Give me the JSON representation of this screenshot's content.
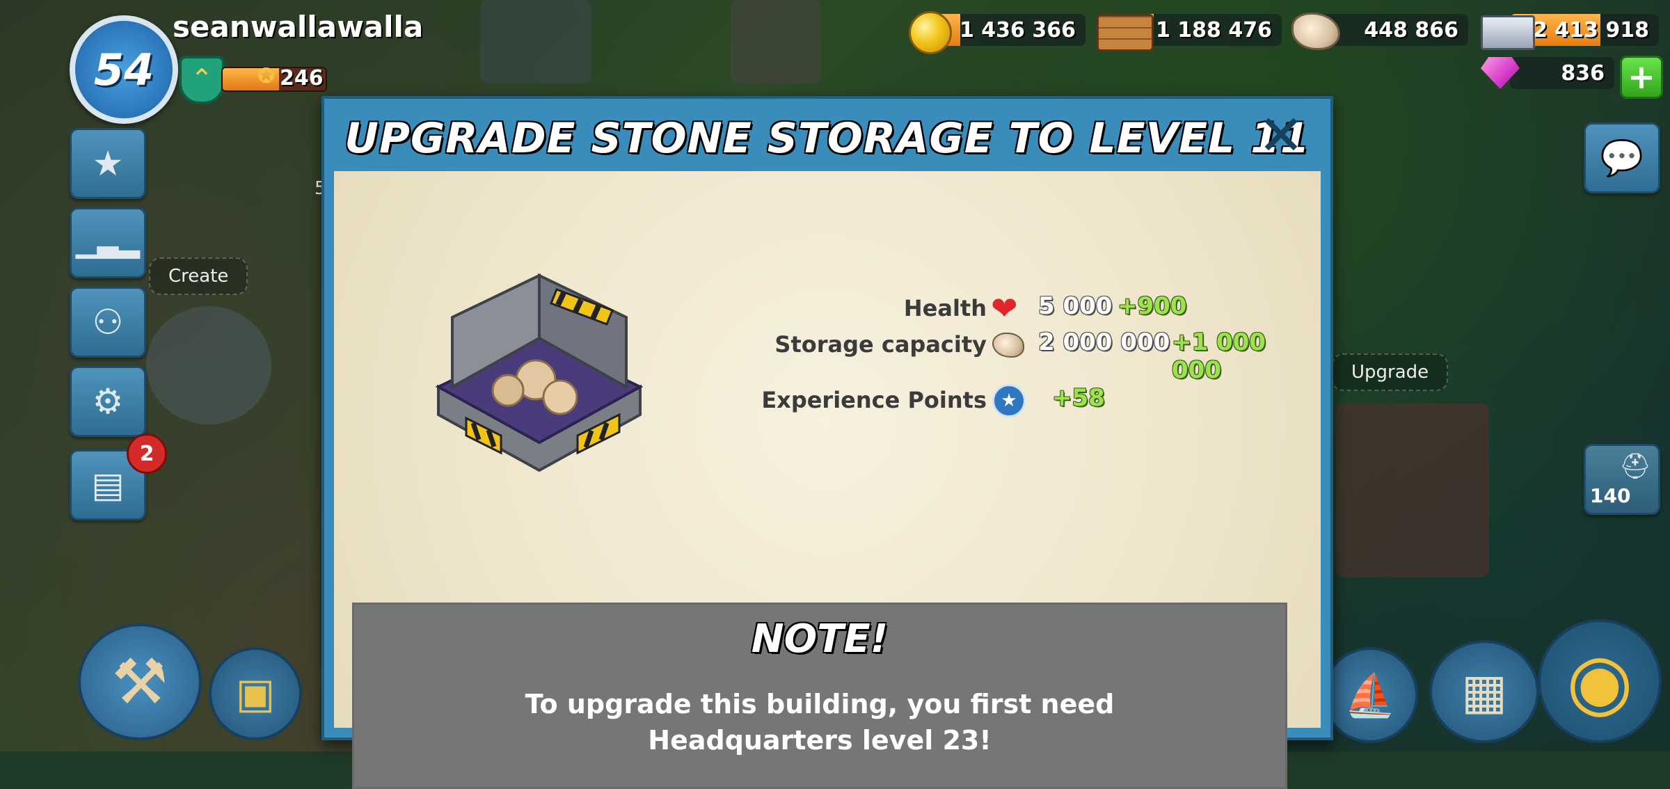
{
  "player": {
    "level": "54",
    "username": "seanwallawalla",
    "xp_value": "246",
    "xp_fill_fraction": 0.55
  },
  "resources": {
    "gold": "1 436 366",
    "wood": "1 188 476",
    "stone": "448 866",
    "iron": "2 413 918",
    "diamonds": "836",
    "add_label": "+"
  },
  "map_labels": {
    "create": "Create",
    "upgrade": "Upgrade",
    "troop_count": "140",
    "partial_num": "5"
  },
  "notifications": {
    "news_count": "2"
  },
  "modal": {
    "title": "UPGRADE STONE STORAGE TO LEVEL 11",
    "close_label": "✕",
    "stats": [
      {
        "label": "Health",
        "value": "5 000",
        "bonus": "+900",
        "icon": "heart-icon"
      },
      {
        "label": "Storage capacity",
        "value": "2 000 000",
        "bonus": "+1 000 000",
        "icon": "stone-icon"
      },
      {
        "label": "Experience Points",
        "value": "",
        "bonus": "+58",
        "icon": "xp-star-icon"
      }
    ],
    "note_title": "NOTE!",
    "note_line1": "To upgrade this building, you first need",
    "note_line2": "Headquarters level 23!"
  },
  "colors": {
    "modal_frame": "#3a8dba",
    "parchment": "#f0e8d2",
    "bonus_green": "#9de34e",
    "note_gray": "#767676"
  }
}
